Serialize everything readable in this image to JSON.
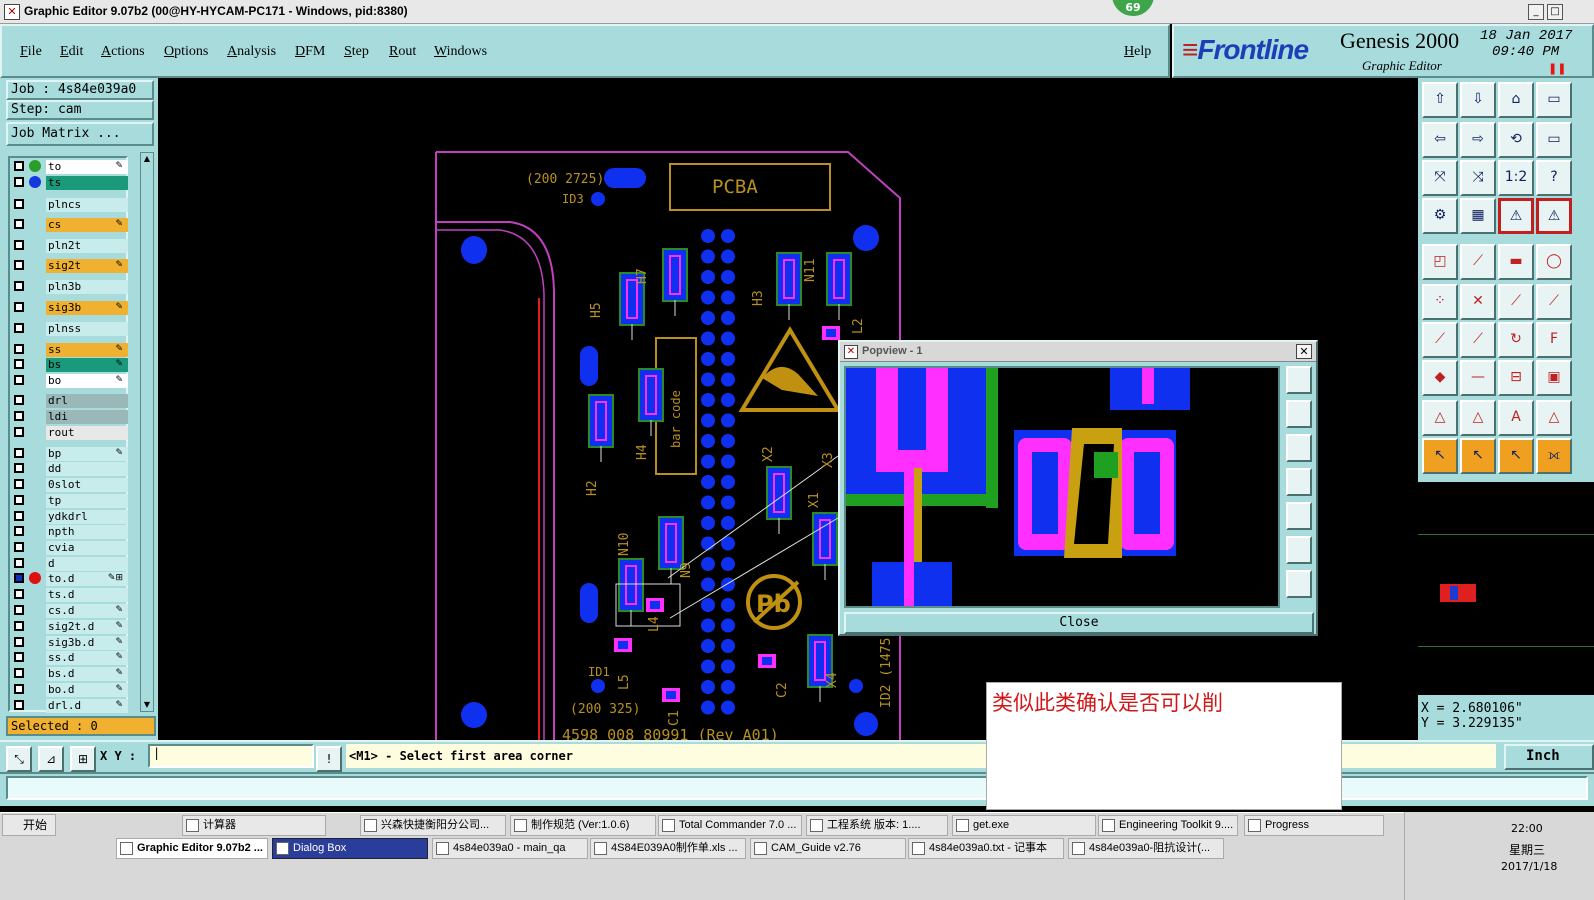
{
  "window": {
    "title": "Graphic Editor 9.07b2 (00@HY-HYCAM-PC171 - Windows, pid:8380)",
    "mem_badge": "69"
  },
  "menu": [
    "File",
    "Edit",
    "Actions",
    "Options",
    "Analysis",
    "DFM",
    "Step",
    "Rout",
    "Windows"
  ],
  "help_label": "Help",
  "brand": {
    "logo": "Frontline",
    "product": "Genesis 2000",
    "subtitle": "Graphic Editor",
    "date": "18 Jan 2017",
    "time": "09:40 PM"
  },
  "job": {
    "job_line": "Job : 4s84e039a0",
    "step_line": "Step: cam",
    "matrix_button": "Job Matrix ..."
  },
  "layers": [
    {
      "name": "to",
      "color": "#ffffff",
      "dot": "#2a9d2a",
      "icon": "✎"
    },
    {
      "name": "ts",
      "color": "#1a9a7a",
      "dot": "#1638e0",
      "icon": ""
    },
    {
      "name": "plncs",
      "color": "#c8ecec",
      "dot": "",
      "icon": ""
    },
    {
      "name": "cs",
      "color": "#f0b030",
      "dot": "",
      "icon": "✎"
    },
    {
      "name": "pln2t",
      "color": "#c8ecec",
      "dot": "",
      "icon": ""
    },
    {
      "name": "sig2t",
      "color": "#f0b030",
      "dot": "",
      "icon": "✎"
    },
    {
      "name": "pln3b",
      "color": "#c8ecec",
      "dot": "",
      "icon": ""
    },
    {
      "name": "sig3b",
      "color": "#f0b030",
      "dot": "",
      "icon": "✎"
    },
    {
      "name": "plnss",
      "color": "#c8ecec",
      "dot": "",
      "icon": ""
    },
    {
      "name": "ss",
      "color": "#f0b030",
      "dot": "",
      "icon": "✎"
    },
    {
      "name": "bs",
      "color": "#1a9a7a",
      "dot": "",
      "icon": "✎"
    },
    {
      "name": "bo",
      "color": "#ffffff",
      "dot": "",
      "icon": "✎"
    },
    {
      "name": "drl",
      "color": "#9ab8b8",
      "dot": "",
      "icon": ""
    },
    {
      "name": "ldi",
      "color": "#9ab8b8",
      "dot": "",
      "icon": ""
    },
    {
      "name": "rout",
      "color": "#e8e8e8",
      "dot": "",
      "icon": ""
    },
    {
      "name": "bp",
      "color": "#c8ecec",
      "dot": "",
      "icon": "✎"
    },
    {
      "name": "dd",
      "color": "#c8ecec",
      "dot": "",
      "icon": ""
    },
    {
      "name": "0slot",
      "color": "#c8ecec",
      "dot": "",
      "icon": ""
    },
    {
      "name": "tp",
      "color": "#c8ecec",
      "dot": "",
      "icon": ""
    },
    {
      "name": "ydkdrl",
      "color": "#c8ecec",
      "dot": "",
      "icon": ""
    },
    {
      "name": "npth",
      "color": "#c8ecec",
      "dot": "",
      "icon": ""
    },
    {
      "name": "cvia",
      "color": "#c8ecec",
      "dot": "",
      "icon": ""
    },
    {
      "name": "d",
      "color": "#c8ecec",
      "dot": "",
      "icon": ""
    },
    {
      "name": "to.d",
      "color": "#c8ecec",
      "dot": "#e01010",
      "icon": "✎⊞"
    },
    {
      "name": "ts.d",
      "color": "#c8ecec",
      "dot": "",
      "icon": ""
    },
    {
      "name": "cs.d",
      "color": "#c8ecec",
      "dot": "",
      "icon": "✎"
    },
    {
      "name": "sig2t.d",
      "color": "#c8ecec",
      "dot": "",
      "icon": "✎"
    },
    {
      "name": "sig3b.d",
      "color": "#c8ecec",
      "dot": "",
      "icon": "✎"
    },
    {
      "name": "ss.d",
      "color": "#c8ecec",
      "dot": "",
      "icon": "✎"
    },
    {
      "name": "bs.d",
      "color": "#c8ecec",
      "dot": "",
      "icon": "✎"
    },
    {
      "name": "bo.d",
      "color": "#c8ecec",
      "dot": "",
      "icon": "✎"
    },
    {
      "name": "drl.d",
      "color": "#c8ecec",
      "dot": "",
      "icon": "✎"
    }
  ],
  "selected": "Selected : 0",
  "board_text": {
    "pcba": "PCBA",
    "ref_top": "(200 2725)",
    "id3": "ID3",
    "barcode": "bar code",
    "ref_bot": "(200 325)",
    "id1": "ID1",
    "id2": "ID2 (1475",
    "part_no": "4598 008 80991 (Rev A01)",
    "designators": [
      "H5",
      "H7",
      "H3",
      "N11",
      "L2",
      "H4",
      "H2",
      "X2",
      "X3",
      "X1",
      "N10",
      "N9",
      "L4",
      "L5",
      "C1",
      "C2",
      "X4"
    ]
  },
  "popview": {
    "title": "Popview - 1",
    "close_label": "Close"
  },
  "coords": {
    "x": "X = 2.680106\"",
    "y": "Y = 3.229135\""
  },
  "cmd": {
    "xy_label": "X Y :",
    "prompt": "<M1> - Select first area corner",
    "unit": "Inch"
  },
  "note": "类似此类确认是否可以削",
  "taskbar": {
    "start": "开始",
    "row1": [
      "计算器",
      "兴森快捷衡阳分公司...",
      "制作规范 (Ver:1.0.6)",
      "Total Commander 7.0 ...",
      "工程系统  版本: 1....",
      "get.exe",
      "Engineering Toolkit 9....",
      "Progress"
    ],
    "row2": [
      "Graphic Editor 9.07b2 ...",
      "Dialog Box",
      "4s84e039a0 - main_qa",
      "4S84E039A0制作单.xls ...",
      "CAM_Guide v2.76",
      "4s84e039a0.txt - 记事本",
      "4s84e039a0-阻抗设计(..."
    ],
    "clock": "22:00",
    "weekday": "星期三",
    "date": "2017/1/18"
  }
}
